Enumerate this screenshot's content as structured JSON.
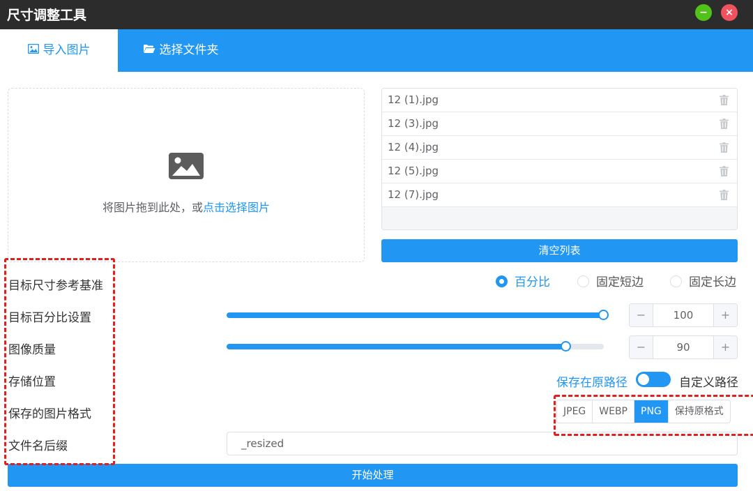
{
  "window": {
    "title": "尺寸调整工具",
    "minimize_glyph": "−",
    "close_glyph": "×",
    "minimize_color": "#52c21b",
    "close_color": "#f0535d"
  },
  "tabs": [
    {
      "label": "导入图片",
      "icon": "image-icon",
      "active": true
    },
    {
      "label": "选择文件夹",
      "icon": "folder-open-icon",
      "active": false
    }
  ],
  "dropzone": {
    "icon": "image-placeholder-icon",
    "hint_prefix": "将图片拖到此处，或",
    "hint_link": "点击选择图片"
  },
  "files": [
    {
      "name": "12 (1).jpg"
    },
    {
      "name": "12 (3).jpg"
    },
    {
      "name": "12 (4).jpg"
    },
    {
      "name": "12 (5).jpg"
    },
    {
      "name": "12 (7).jpg"
    }
  ],
  "file_action_icon": "trash-icon",
  "clear_button": "清空列表",
  "settings": {
    "reference_label": "目标尺寸参考基准",
    "percent_label": "目标百分比设置",
    "quality_label": "图像质量",
    "storage_label": "存储位置",
    "format_label": "保存的图片格式",
    "suffix_label": "文件名后缀"
  },
  "reference_options": [
    {
      "label": "百分比",
      "checked": true
    },
    {
      "label": "固定短边",
      "checked": false
    },
    {
      "label": "固定长边",
      "checked": false
    }
  ],
  "percent": {
    "value": "100",
    "slider_fraction": 1.0
  },
  "quality": {
    "value": "90",
    "slider_fraction": 0.9
  },
  "stepper_minus": "−",
  "stepper_plus": "+",
  "storage": {
    "left_label": "保存在原路径",
    "right_label": "自定义路径",
    "custom_path": false
  },
  "formats": [
    {
      "label": "JPEG",
      "selected": false
    },
    {
      "label": "WEBP",
      "selected": false
    },
    {
      "label": "PNG",
      "selected": true
    },
    {
      "label": "保持原格式",
      "selected": false
    }
  ],
  "suffix": {
    "value": "_resized"
  },
  "start_button": "开始处理",
  "colors": {
    "accent": "#2196f3",
    "annotation": "#e02020",
    "titlebar": "#2c2c2c"
  }
}
